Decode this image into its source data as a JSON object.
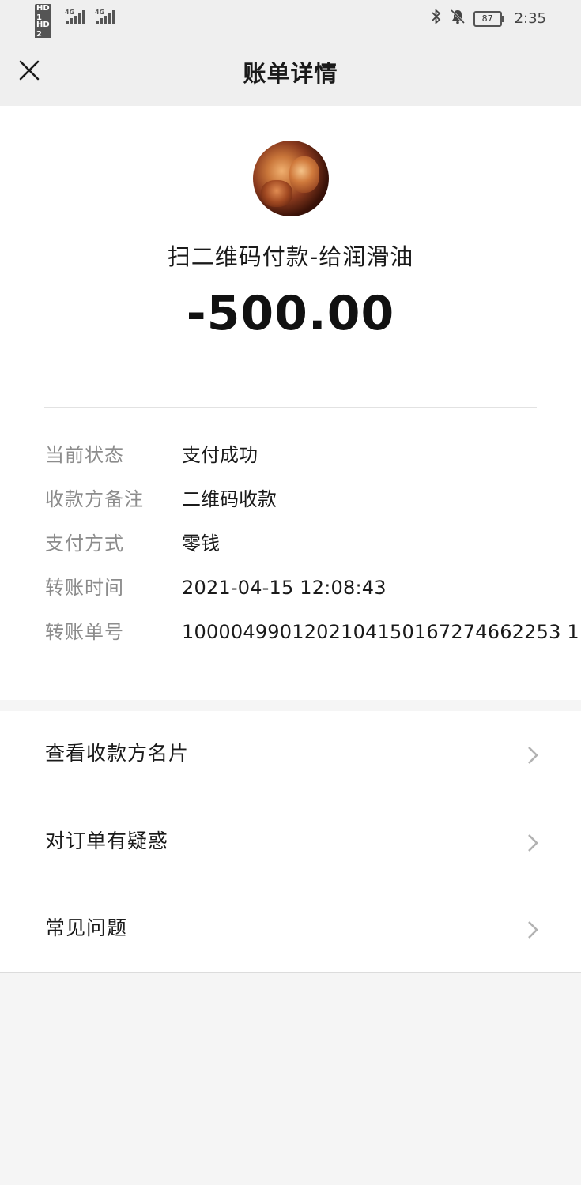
{
  "status_bar": {
    "hd1": "HD 1",
    "hd2": "HD 2",
    "net1": "4G",
    "net2": "4G",
    "battery": "87",
    "time": "2:35"
  },
  "nav": {
    "title": "账单详情"
  },
  "bill": {
    "merchant": "扫二维码付款-给润滑油",
    "amount": "-500.00",
    "details": [
      {
        "key": "当前状态",
        "value": "支付成功"
      },
      {
        "key": "收款方备注",
        "value": "二维码收款"
      },
      {
        "key": "支付方式",
        "value": "零钱"
      },
      {
        "key": "转账时间",
        "value": "2021-04-15 12:08:43"
      },
      {
        "key": "转账单号",
        "value": "1000049901202104150167274662253 1"
      }
    ]
  },
  "links": [
    {
      "label": "查看收款方名片"
    },
    {
      "label": "对订单有疑惑"
    },
    {
      "label": "常见问题"
    }
  ],
  "colors": {
    "nav_bg": "#efefef",
    "card_bg": "#ffffff",
    "label_gray": "#8c8c8c",
    "page_bg": "#f5f5f5"
  }
}
